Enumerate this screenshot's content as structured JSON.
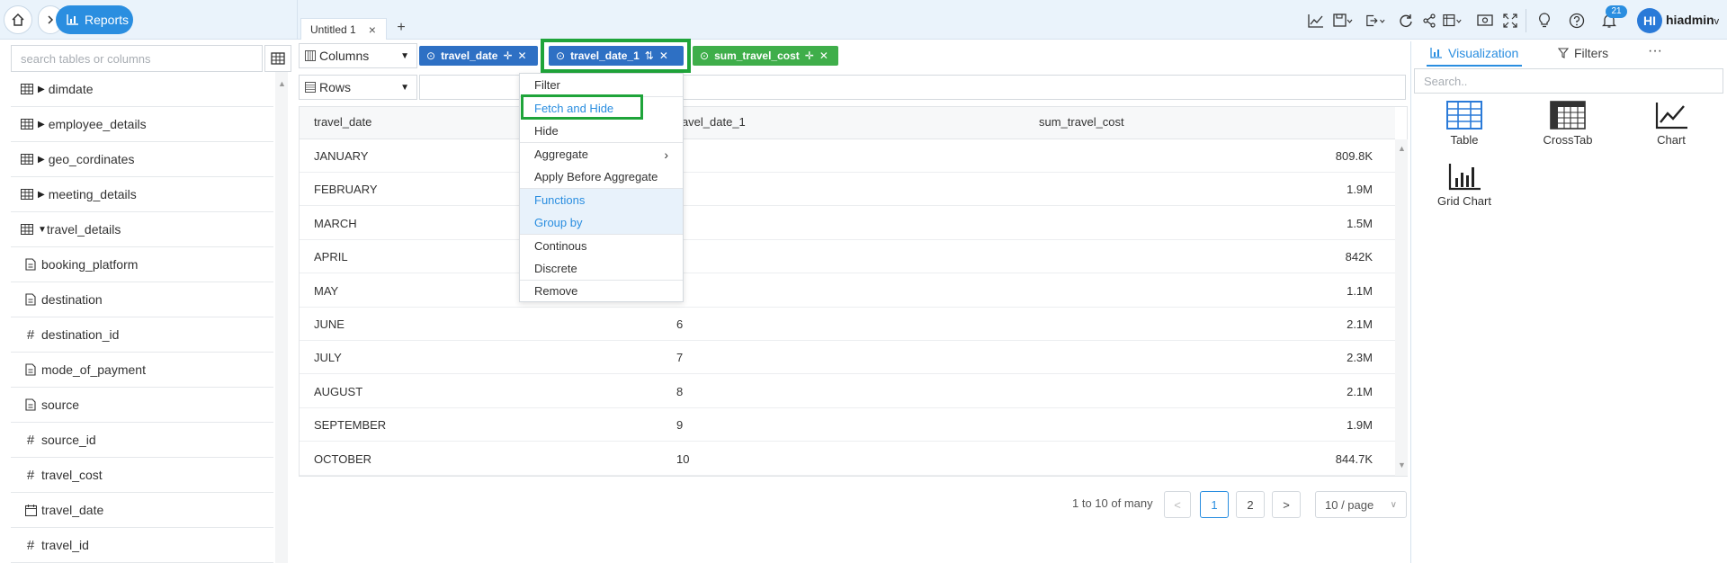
{
  "nav": {
    "reports_label": "Reports"
  },
  "tabs": [
    {
      "label": "Untitled 1"
    }
  ],
  "user": {
    "initials": "HI",
    "name": "hiadmin",
    "notifications": "21"
  },
  "left_panel": {
    "search_placeholder": "search tables or columns",
    "tables": [
      {
        "name": "dimdate",
        "expanded": false
      },
      {
        "name": "employee_details",
        "expanded": false
      },
      {
        "name": "geo_cordinates",
        "expanded": false
      },
      {
        "name": "meeting_details",
        "expanded": false
      },
      {
        "name": "travel_details",
        "expanded": true
      }
    ],
    "columns": [
      {
        "name": "booking_platform",
        "type": "text"
      },
      {
        "name": "destination",
        "type": "text"
      },
      {
        "name": "destination_id",
        "type": "number"
      },
      {
        "name": "mode_of_payment",
        "type": "text"
      },
      {
        "name": "source",
        "type": "text"
      },
      {
        "name": "source_id",
        "type": "number"
      },
      {
        "name": "travel_cost",
        "type": "number"
      },
      {
        "name": "travel_date",
        "type": "date"
      },
      {
        "name": "travel_id",
        "type": "number"
      }
    ]
  },
  "shelves": {
    "columns_label": "Columns",
    "rows_label": "Rows",
    "pills": [
      "travel_date",
      "travel_date_1",
      "sum_travel_cost"
    ]
  },
  "context_menu": {
    "items": [
      {
        "label": "Filter"
      },
      {
        "label": "Fetch and Hide"
      },
      {
        "label": "Hide"
      },
      {
        "label": "Aggregate"
      },
      {
        "label": "Apply Before Aggregate"
      },
      {
        "label": "Functions"
      },
      {
        "label": "Group by"
      },
      {
        "label": "Continous"
      },
      {
        "label": "Discrete"
      },
      {
        "label": "Remove"
      }
    ]
  },
  "table": {
    "headers": [
      "travel_date",
      "travel_date_1",
      "sum_travel_cost"
    ],
    "rows": [
      [
        "JANUARY",
        "",
        "809.8K"
      ],
      [
        "FEBRUARY",
        "",
        "1.9M"
      ],
      [
        "MARCH",
        "",
        "1.5M"
      ],
      [
        "APRIL",
        "",
        "842K"
      ],
      [
        "MAY",
        "",
        "1.1M"
      ],
      [
        "JUNE",
        "6",
        "2.1M"
      ],
      [
        "JULY",
        "7",
        "2.3M"
      ],
      [
        "AUGUST",
        "8",
        "2.1M"
      ],
      [
        "SEPTEMBER",
        "9",
        "1.9M"
      ],
      [
        "OCTOBER",
        "10",
        "844.7K"
      ]
    ]
  },
  "pagination": {
    "info": "1 to 10 of many",
    "page1": "1",
    "page2": "2",
    "page_size": "10 / page"
  },
  "right_panel": {
    "tab_visualization": "Visualization",
    "tab_filters": "Filters",
    "more": "···",
    "search_placeholder": "Search..",
    "viz_types": [
      "Table",
      "CrossTab",
      "Chart",
      "Grid Chart"
    ]
  },
  "colors": {
    "accent": "#2a8ee0",
    "pill_blue": "#2e70c4",
    "pill_green": "#3fae4a",
    "highlight_green": "#1fa43a"
  }
}
